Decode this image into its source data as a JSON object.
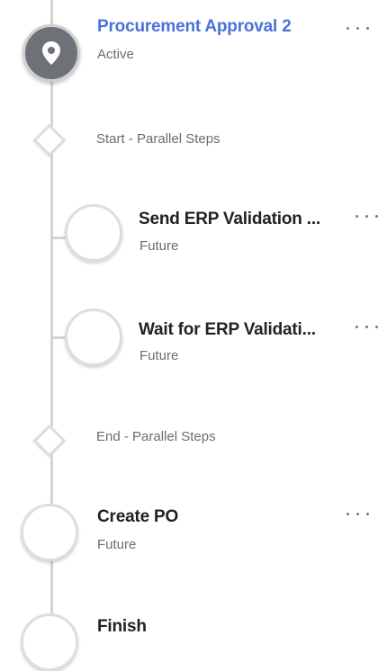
{
  "steps": [
    {
      "title": "Procurement Approval 2",
      "status": "Active"
    },
    {
      "title": "Send ERP Validation ...",
      "status": "Future"
    },
    {
      "title": "Wait for ERP Validati...",
      "status": "Future"
    },
    {
      "title": "Create PO",
      "status": "Future"
    },
    {
      "title": "Finish",
      "status": ""
    }
  ],
  "gateways": {
    "start_label": "Start - Parallel Steps",
    "end_label": "End - Parallel Steps"
  },
  "icons": {
    "active_step": "location-pin-icon",
    "more": "more-horizontal-icon"
  },
  "colors": {
    "active_title": "#4a72d8",
    "active_node": "#6e7178",
    "connector": "#d4d4d4"
  }
}
